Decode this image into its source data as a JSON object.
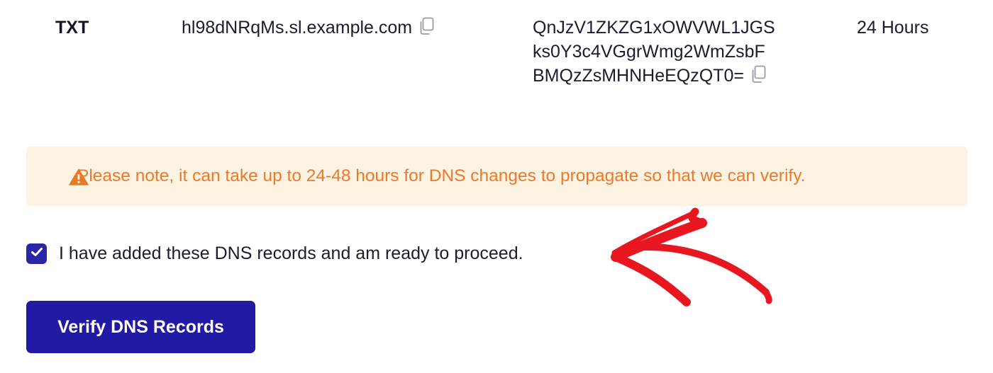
{
  "record": {
    "type": "TXT",
    "host": "hl98dNRqMs.sl.example.com",
    "value_lines": [
      "QnJzV1ZKZG1xOWVWL1JGS",
      "ks0Y3c4VGgrWmg2WmZsbF",
      "BMQzZsMHNHeEQzQT0="
    ],
    "ttl": "24 Hours"
  },
  "notice": {
    "text": "Please note, it can take up to 24-48 hours for DNS changes to propagate so that we can verify.",
    "text_color": "#ea7a2a",
    "background": "#fdf3e3"
  },
  "confirm": {
    "label": "I have added these DNS records and am ready to proceed.",
    "checked": true
  },
  "actions": {
    "verify_label": "Verify DNS Records"
  },
  "icons": {
    "copy": "copy-icon",
    "warning": "warning-triangle-icon",
    "check": "checkmark-icon",
    "annotation": "red-arrow-annotation"
  },
  "colors": {
    "primary": "#2219a4",
    "annotation": "#e8161f",
    "text": "#1c1c2e"
  }
}
